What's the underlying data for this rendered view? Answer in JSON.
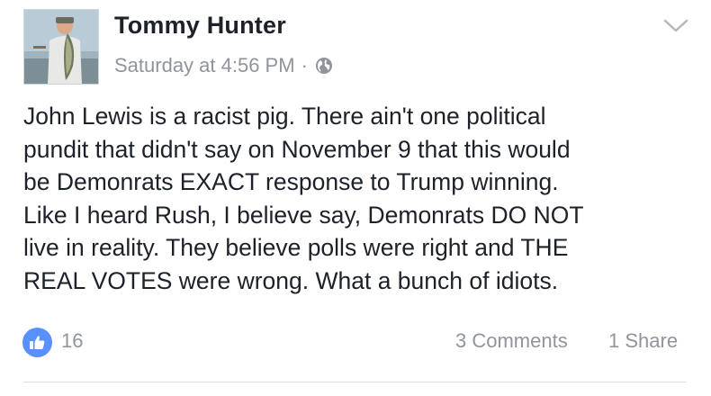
{
  "post": {
    "author": "Tommy Hunter",
    "timestamp": "Saturday at 4:56 PM",
    "separator": "·",
    "privacy_icon": "globe-icon",
    "menu_icon": "chevron-down-icon",
    "text_lines": [
      "John Lewis is a racist pig.  There ain't one political",
      "pundit that didn't say on November 9 that this would",
      "be Demonrats EXACT response to Trump winning.",
      "Like I heard Rush, I believe say, Demonrats DO NOT",
      "live in reality. They believe polls were right and THE",
      "REAL VOTES were wrong. What a bunch of idiots."
    ]
  },
  "footer": {
    "like_icon": "thumbs-up-icon",
    "like_count": "16",
    "comments": "3 Comments",
    "shares": "1 Share"
  },
  "colors": {
    "text": "#1d2129",
    "meta": "#90949c",
    "like_blue": "#5890ff",
    "divider": "#dddfe2"
  }
}
